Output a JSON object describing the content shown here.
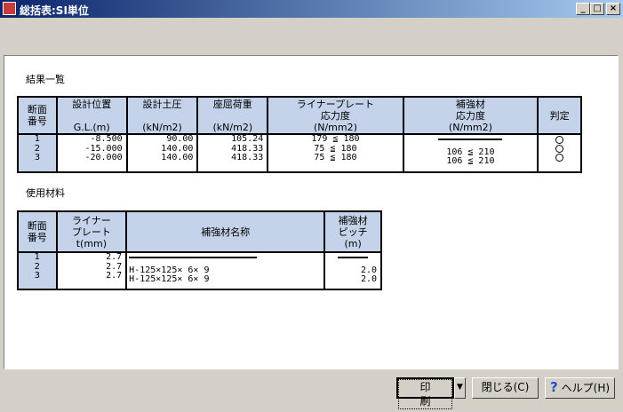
{
  "window": {
    "title": "総括表:SI単位",
    "min_label": "_",
    "max_label": "□",
    "close_label": "×"
  },
  "results": {
    "title": "結果一覧",
    "headers": {
      "section": "断面\n番号",
      "position": "設計位置\n\nG.L.(m)",
      "pressure": "設計土圧\n\n(kN/m2)",
      "buckling": "座屈荷重\n\n(kN/m2)",
      "liner_stress": "ライナープレート\n応力度\n(N/mm2)",
      "reinf_stress": "補強材\n応力度\n(N/mm2)",
      "judgment": "判定"
    },
    "rows": [
      {
        "no": "1",
        "position": "-8.500",
        "pressure": "90.00",
        "buckling": "105.24",
        "liner": "179 ≦ 180",
        "reinf": "",
        "reinf_dash": true
      },
      {
        "no": "2",
        "position": "-15.000",
        "pressure": "140.00",
        "buckling": "418.33",
        "liner": "75 ≦ 180",
        "reinf": "106 ≦ 210",
        "reinf_dash": false
      },
      {
        "no": "3",
        "position": "-20.000",
        "pressure": "140.00",
        "buckling": "418.33",
        "liner": "75 ≦ 180",
        "reinf": "106 ≦ 210",
        "reinf_dash": false
      }
    ]
  },
  "materials": {
    "title": "使用材料",
    "headers": {
      "section": "断面\n番号",
      "liner": "ライナー\nプレート\nt(mm)",
      "name": "補強材名称",
      "pitch": "補強材\nピッチ\n(m)"
    },
    "rows": [
      {
        "no": "1",
        "liner": "2.7",
        "name": "",
        "pitch": "",
        "dash": true
      },
      {
        "no": "2",
        "liner": "2.7",
        "name": "H-125×125× 6× 9",
        "pitch": "2.0",
        "dash": false
      },
      {
        "no": "3",
        "liner": "2.7",
        "name": "H-125×125× 6× 9",
        "pitch": "2.0",
        "dash": false
      }
    ]
  },
  "buttons": {
    "print": "印刷",
    "print_dropdown": "▼",
    "close": "閉じる(C)",
    "help": "ヘルプ(H)",
    "help_icon": "?"
  }
}
